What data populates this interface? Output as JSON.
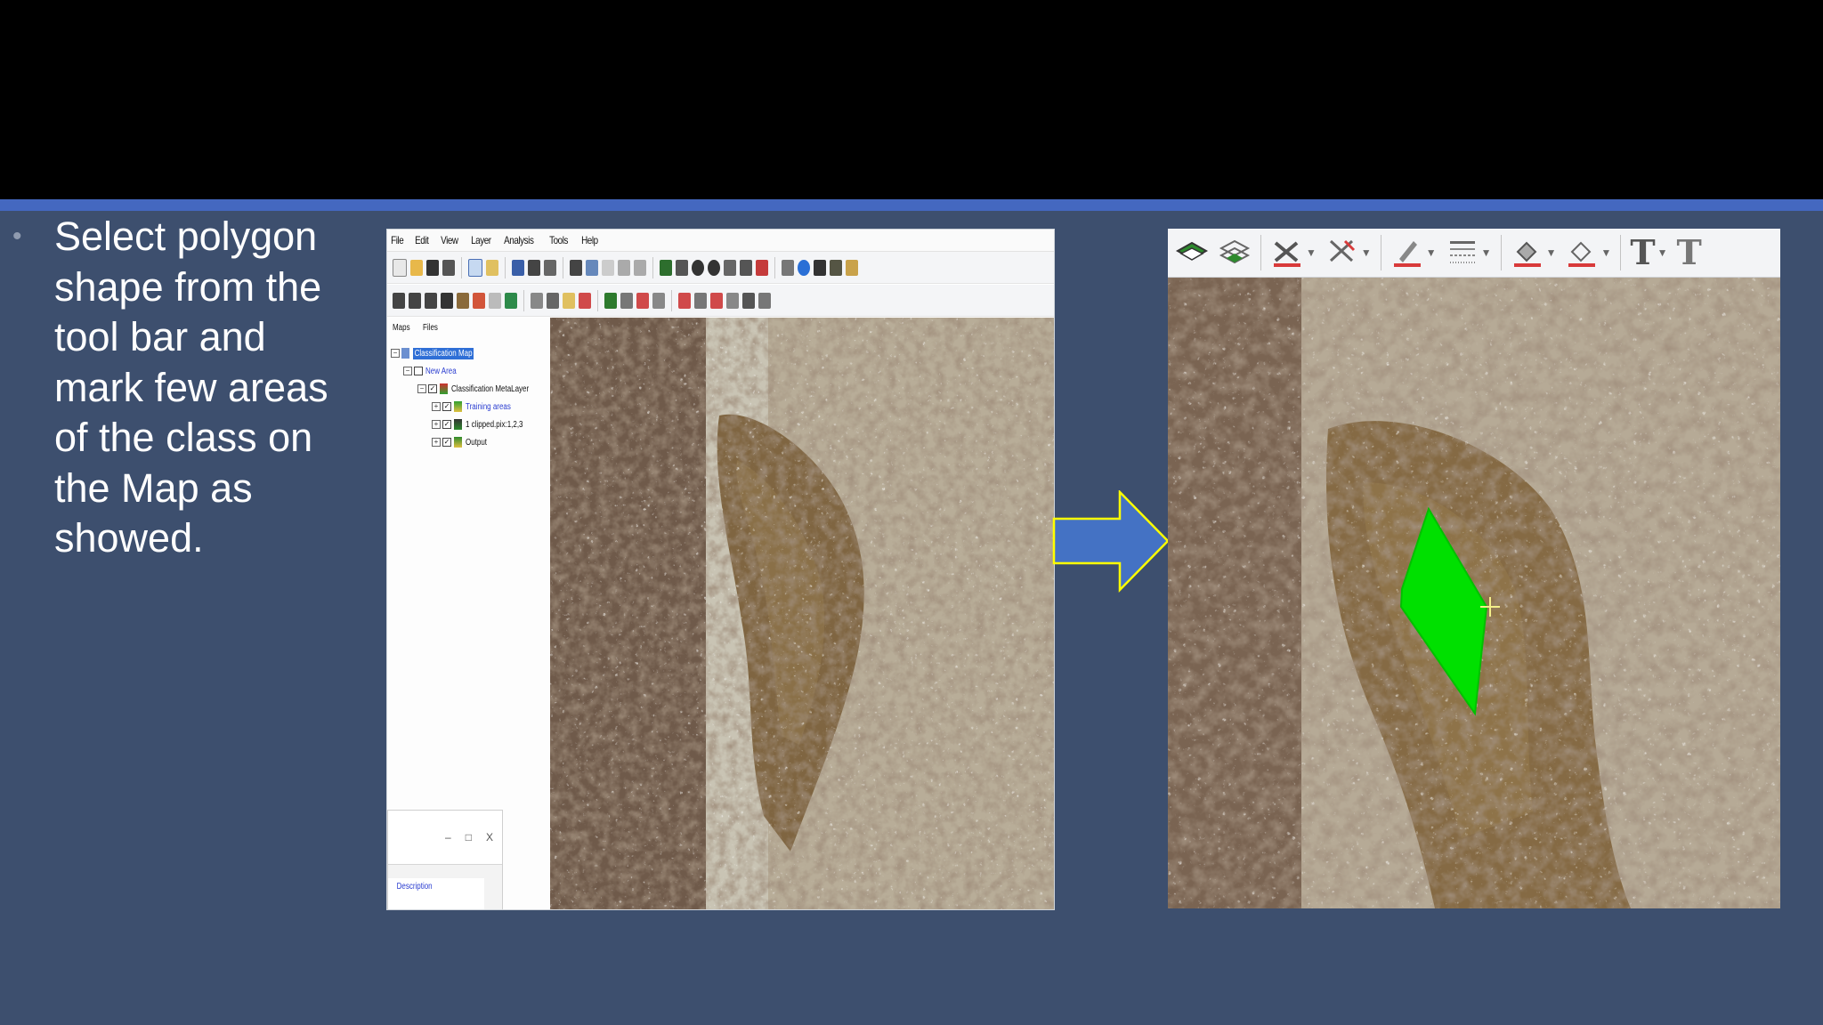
{
  "slide": {
    "bullet": "Select polygon\nshape from the\ntool bar and\nmark few areas\nof the class on\nthe Map as\nshowed.",
    "colors": {
      "background": "#3d4f6e",
      "accent_bar": "#4468c0",
      "arrow_fill": "#4472c4",
      "arrow_stroke": "#ffff00",
      "polygon": "#00e000"
    }
  },
  "app": {
    "menu": [
      "File",
      "Edit",
      "View",
      "Layer",
      "Analysis",
      "Tools",
      "Help"
    ],
    "panel_tabs": [
      "Maps",
      "Files"
    ],
    "tree": [
      {
        "label": "Classification Map",
        "expander": "−",
        "checked": false,
        "icon": "map-icon",
        "selected": true
      },
      {
        "label": "New Area",
        "expander": "−",
        "checked": false,
        "icon": "area-icon"
      },
      {
        "label": "Classification MetaLayer",
        "expander": "−",
        "checked": true,
        "icon": "metalayer-icon"
      },
      {
        "label": "Training areas",
        "expander": "+",
        "checked": true,
        "icon": "training-icon",
        "blue": true
      },
      {
        "label": "1 clipped.pix:1,2,3",
        "expander": "+",
        "checked": true,
        "icon": "raster-icon"
      },
      {
        "label": "Output",
        "expander": "+",
        "checked": true,
        "icon": "output-icon"
      }
    ],
    "dialog": {
      "minimize": "–",
      "maximize": "□",
      "close": "X",
      "description_label": "Description"
    }
  },
  "right_toolbar": {
    "icons": [
      "layers-icon",
      "layers-outline-icon",
      "polygon-tool-icon",
      "line-tool-icon",
      "pen-icon",
      "line-style-icon",
      "fill-color-icon",
      "outline-color-icon",
      "text-icon",
      "text-style-icon"
    ],
    "text_glyph": "T"
  }
}
